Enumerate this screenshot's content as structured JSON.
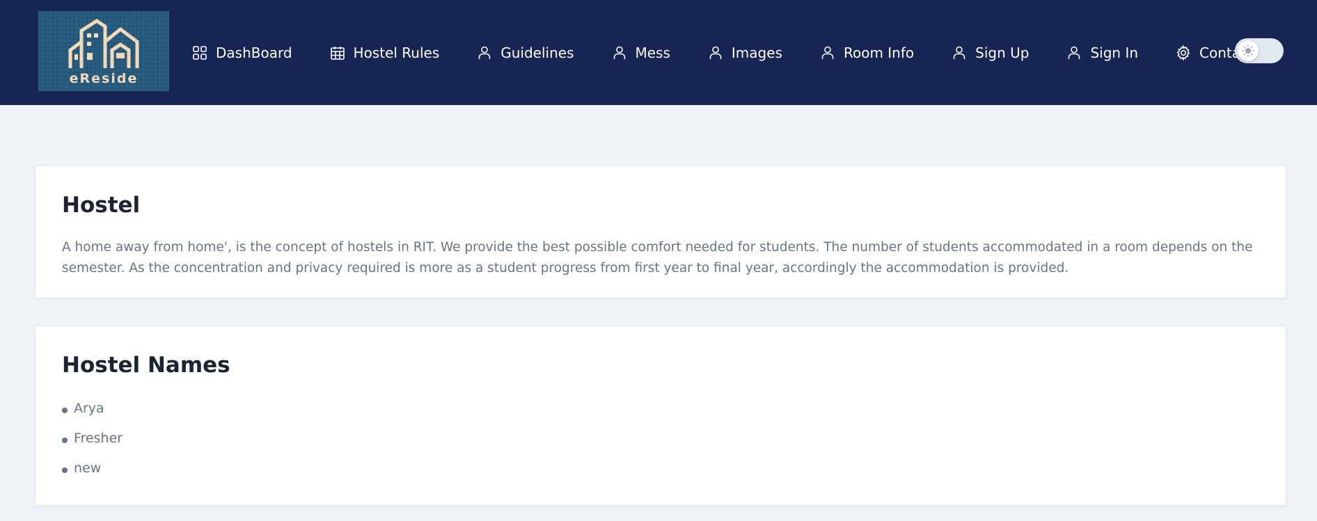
{
  "header": {
    "logo_text": "eReside",
    "nav": [
      {
        "label": "DashBoard",
        "icon": "grid-icon"
      },
      {
        "label": "Hostel Rules",
        "icon": "calendar-icon"
      },
      {
        "label": "Guidelines",
        "icon": "user-icon"
      },
      {
        "label": "Mess",
        "icon": "user-icon"
      },
      {
        "label": "Images",
        "icon": "user-icon"
      },
      {
        "label": "Room Info",
        "icon": "user-icon"
      },
      {
        "label": "Sign Up",
        "icon": "user-icon"
      },
      {
        "label": "Sign In",
        "icon": "user-icon"
      },
      {
        "label": "Contact",
        "icon": "gear-icon"
      }
    ],
    "theme_toggle_icon": "sun-icon"
  },
  "hostel_card": {
    "title": "Hostel",
    "description": "A home away from home', is the concept of hostels in RIT. We provide the best possible comfort needed for students. The number of students accommodated in a room depends on the semester. As the concentration and privacy required is more as a student progress from first year to final year, accordingly the accommodation is provided."
  },
  "names_card": {
    "title": "Hostel Names",
    "items": [
      "Arya",
      "Fresher",
      "new"
    ]
  },
  "colors": {
    "header_bg": "#172554",
    "page_bg": "#eff3f8",
    "logo_bg": "#22577a",
    "logo_accent": "#f3d9b8",
    "muted_text": "#64748b"
  }
}
